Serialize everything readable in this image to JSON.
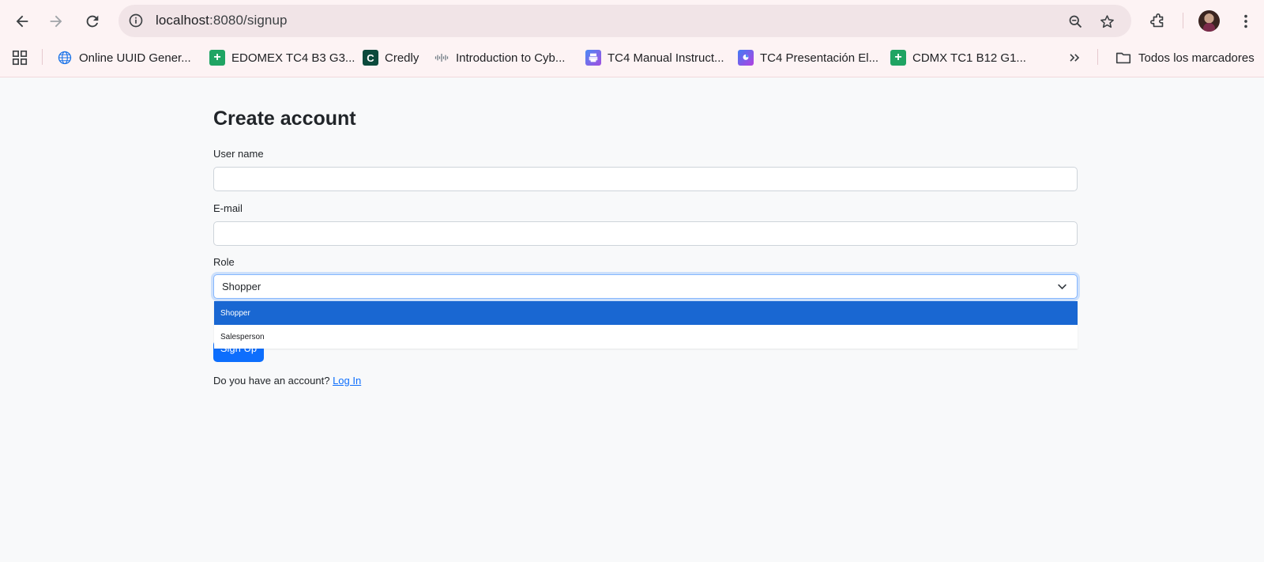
{
  "browser": {
    "url_host": "localhost",
    "url_path": ":8080/signup",
    "bookmarks": [
      {
        "label": "Online UUID Gener...",
        "icon": "globe-icon"
      },
      {
        "label": "EDOMEX TC4 B3 G3...",
        "icon": "sheets-icon"
      },
      {
        "label": "Credly",
        "icon": "credly-icon"
      },
      {
        "label": "Introduction to Cyb...",
        "icon": "cisco-icon"
      },
      {
        "label": "TC4 Manual Instruct...",
        "icon": "printer-icon"
      },
      {
        "label": "TC4 Presentación El...",
        "icon": "presentation-icon"
      },
      {
        "label": "CDMX TC1 B12 G1...",
        "icon": "sheets-icon"
      }
    ],
    "all_bookmarks_label": "Todos los marcadores"
  },
  "form": {
    "title": "Create account",
    "username_label": "User name",
    "username_value": "",
    "email_label": "E-mail",
    "email_value": "",
    "role_label": "Role",
    "role_selected": "Shopper",
    "role_options": [
      "Shopper",
      "Salesperson"
    ],
    "submit_label": "Sign Up",
    "account_prompt": "Do you have an account?",
    "login_link": "Log In"
  },
  "colors": {
    "primary": "#0d6efd",
    "dropdown_highlight": "#1967d2",
    "page_background": "#f8f9fa",
    "chrome_background": "#fdf3f4"
  }
}
